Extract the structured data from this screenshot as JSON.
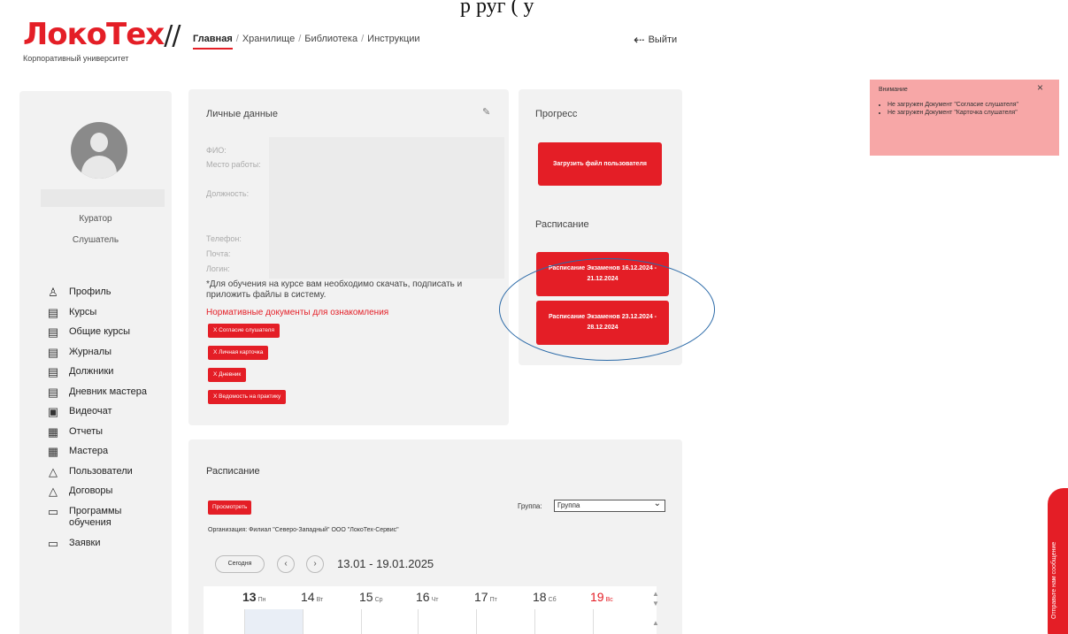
{
  "doc_text": "р                      руг (  у",
  "logo": {
    "brand_a": "Локо",
    "brand_b": "Тех",
    "slashes": "//",
    "subtitle": "Корпоративный университет"
  },
  "nav": {
    "items": [
      "Главная",
      "Хранилище",
      "Библиотека",
      "Инструкции"
    ],
    "separator": "/"
  },
  "logout": {
    "label": "Выйти",
    "icon": "logout-icon"
  },
  "profile": {
    "roles": [
      "Куратор",
      "Слушатель"
    ]
  },
  "menu": [
    {
      "label": "Профиль",
      "icon": "user-icon",
      "glyph": "♙"
    },
    {
      "label": "Курсы",
      "icon": "document-icon",
      "glyph": "▤"
    },
    {
      "label": "Общие курсы",
      "icon": "document-icon",
      "glyph": "▤"
    },
    {
      "label": "Журналы",
      "icon": "document-icon",
      "glyph": "▤"
    },
    {
      "label": "Должники",
      "icon": "document-icon",
      "glyph": "▤"
    },
    {
      "label": "Дневник мастера",
      "icon": "document-icon",
      "glyph": "▤"
    },
    {
      "label": "Видеочат",
      "icon": "video-icon",
      "glyph": "▣"
    },
    {
      "label": "Отчеты",
      "icon": "report-icon",
      "glyph": "▦"
    },
    {
      "label": "Мастера",
      "icon": "report-icon",
      "glyph": "▦"
    },
    {
      "label": "Пользователи",
      "icon": "users-icon",
      "glyph": "△"
    },
    {
      "label": "Договоры",
      "icon": "users-icon",
      "glyph": "△"
    },
    {
      "label": "Программы обучения",
      "icon": "program-icon",
      "glyph": "▭"
    },
    {
      "label": "Заявки",
      "icon": "request-icon",
      "glyph": "▭"
    }
  ],
  "personal": {
    "title": "Личные данные",
    "edit_icon": "pencil-icon",
    "fields": [
      "ФИО:",
      "Место работы:",
      "Должность:",
      "Телефон:",
      "Почта:",
      "Логин:"
    ],
    "note": "*Для обучения на курсе вам необходимо скачать, подписать и приложить файлы в систему.",
    "norm_link": "Нормативные документы для ознакомления",
    "docs": [
      "Х Согласие слушателя",
      "Х Личная карточка",
      "Х Дневник",
      "Х Ведомость на практику"
    ]
  },
  "progress": {
    "title": "Прогресс",
    "upload_btn": "Загрузить файл пользователя",
    "schedule_title": "Расписание",
    "exam_btns": [
      "Расписание Экзаменов 16.12.2024 - 21.12.2024",
      "Расписание Экзаменов 23.12.2024 - 28.12.2024"
    ]
  },
  "notification": {
    "title": "Внимание",
    "close": "×",
    "items": [
      "Не загружен Документ \"Согласие слушателя\"",
      "Не загружен Документ \"Карточка слушателя\""
    ]
  },
  "feedback_tab": "Отправьте нам сообщение",
  "schedule": {
    "title": "Расписание",
    "view_btn": "Просмотреть",
    "group_label": "Группа:",
    "group_value": "Группа",
    "org": "Организация: Филиал \"Северо-Западный\" ООО \"ЛокоТех-Сервис\"",
    "today_btn": "Сегодня",
    "prev": "‹",
    "next": "›",
    "range": "13.01 - 19.01.2025",
    "days": [
      {
        "num": "13",
        "wd": "Пн"
      },
      {
        "num": "14",
        "wd": "Вт"
      },
      {
        "num": "15",
        "wd": "Ср"
      },
      {
        "num": "16",
        "wd": "Чт"
      },
      {
        "num": "17",
        "wd": "Пт"
      },
      {
        "num": "18",
        "wd": "Сб"
      },
      {
        "num": "19",
        "wd": "Вс"
      }
    ]
  },
  "colors": {
    "accent": "#e41e26",
    "panel": "#f2f2f2",
    "notification": "#f7a7a7",
    "ellipse": "#2b6aa8"
  }
}
